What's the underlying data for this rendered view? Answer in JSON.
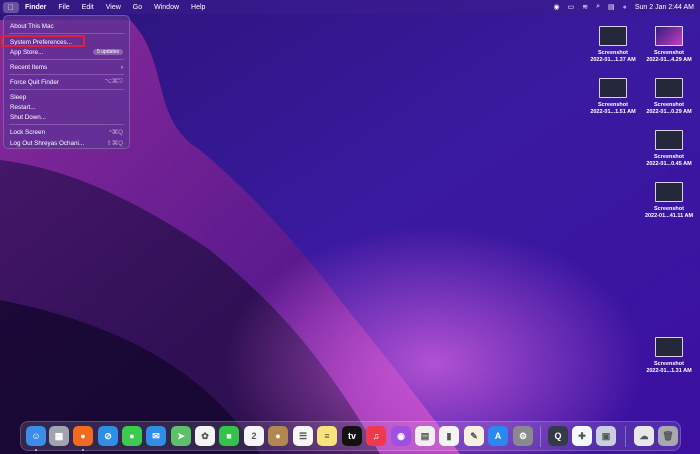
{
  "menubar": {
    "apple": "",
    "items": [
      "Finder",
      "File",
      "Edit",
      "View",
      "Go",
      "Window",
      "Help"
    ],
    "datetime": "Sun 2 Jan  2:44 AM"
  },
  "apple_menu": {
    "about": "About This Mac",
    "system_preferences": "System Preferences...",
    "app_store": "App Store...",
    "app_store_badge": "5 updates",
    "recent_items": "Recent Items",
    "recent_arrow": "›",
    "force_quit": "Force Quit Finder",
    "force_quit_shortcut": "⌥⌘⎋",
    "sleep": "Sleep",
    "restart": "Restart...",
    "shut_down": "Shut Down...",
    "lock_screen": "Lock Screen",
    "lock_shortcut": "^⌘Q",
    "log_out": "Log Out Shreyas Ochani...",
    "log_out_shortcut": "⇧⌘Q"
  },
  "desktop_icons": [
    {
      "title": "Screenshot",
      "subtitle": "2022-01...1.37 AM"
    },
    {
      "title": "Screenshot",
      "subtitle": "2022-01...4.29 AM"
    },
    {
      "title": "Screenshot",
      "subtitle": "2022-01...1.51 AM"
    },
    {
      "title": "Screenshot",
      "subtitle": "2022-01...0.29 AM"
    },
    {
      "title": "Screenshot",
      "subtitle": "2022-01...0.45 AM"
    },
    {
      "title": "Screenshot",
      "subtitle": "2022-01...41.11 AM"
    },
    {
      "title": "Screenshot",
      "subtitle": "2022-01...1.31 AM"
    }
  ],
  "dock": [
    {
      "name": "finder",
      "color": "#3a8ee8",
      "glyph": "☺",
      "running": true
    },
    {
      "name": "launchpad",
      "color": "#a0a4b0",
      "glyph": "▦"
    },
    {
      "name": "firefox",
      "color": "#f26b1d",
      "glyph": "●",
      "running": true
    },
    {
      "name": "safari",
      "color": "#2f8fe6",
      "glyph": "⊘"
    },
    {
      "name": "messages",
      "color": "#3ccb4e",
      "glyph": "●"
    },
    {
      "name": "mail",
      "color": "#2f8fe6",
      "glyph": "✉"
    },
    {
      "name": "maps",
      "color": "#5cc26a",
      "glyph": "➤"
    },
    {
      "name": "photos",
      "color": "#f4f4f4",
      "glyph": "✿"
    },
    {
      "name": "facetime",
      "color": "#34c24a",
      "glyph": "■"
    },
    {
      "name": "calendar",
      "color": "#f6f6f6",
      "glyph": "2"
    },
    {
      "name": "contacts",
      "color": "#b08850",
      "glyph": "●"
    },
    {
      "name": "reminders",
      "color": "#f6f6f6",
      "glyph": "☰"
    },
    {
      "name": "notes",
      "color": "#f8e27a",
      "glyph": "≡"
    },
    {
      "name": "tv",
      "color": "#111111",
      "glyph": "tv"
    },
    {
      "name": "music",
      "color": "#f2384e",
      "glyph": "♫"
    },
    {
      "name": "podcasts",
      "color": "#a050e0",
      "glyph": "◉"
    },
    {
      "name": "keynote",
      "color": "#f0f0f0",
      "glyph": "▤"
    },
    {
      "name": "numbers",
      "color": "#f4f4f4",
      "glyph": "▮"
    },
    {
      "name": "pages",
      "color": "#f6f0e0",
      "glyph": "✎"
    },
    {
      "name": "app-store",
      "color": "#2a88f0",
      "glyph": "A"
    },
    {
      "name": "system-preferences",
      "color": "#8a8a8e",
      "glyph": "⚙"
    },
    {
      "name": "quicktime",
      "color": "#333a48",
      "glyph": "Q"
    },
    {
      "name": "plus-app",
      "color": "#f4f8ff",
      "glyph": "✚"
    },
    {
      "name": "preview",
      "color": "#c8d0e0",
      "glyph": "▣"
    },
    {
      "name": "downloads",
      "color": "#e8e8ec",
      "glyph": "☁"
    },
    {
      "name": "trash",
      "color": "#a8a8ae",
      "glyph": "🗑"
    }
  ]
}
